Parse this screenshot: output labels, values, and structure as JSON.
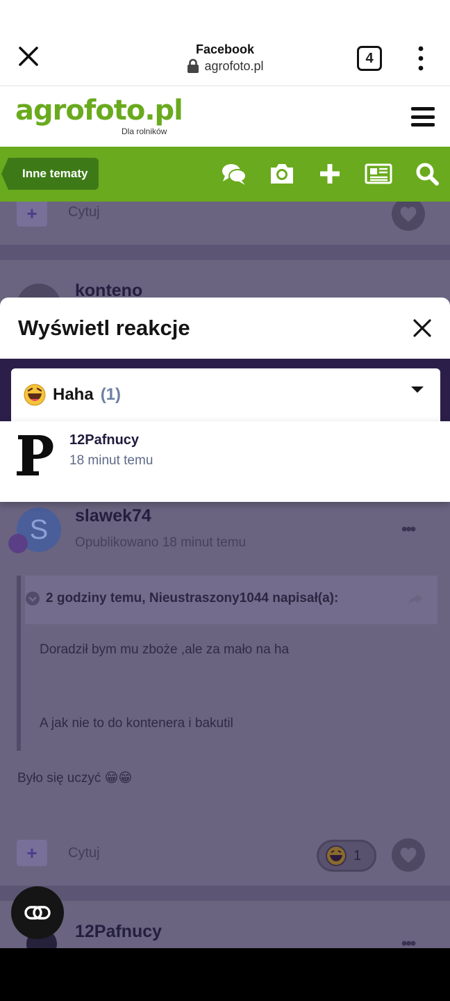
{
  "browser": {
    "site_title": "Facebook",
    "url": "agrofoto.pl",
    "tab_count": "4",
    "icons": [
      "close-icon",
      "lock-icon",
      "more-vert-icon"
    ]
  },
  "site": {
    "logo": "agrofoto.pl",
    "tagline": "Dla rolników",
    "brand_color": "#6aaa1e",
    "brand_dark": "#3d7a17"
  },
  "toolbar": {
    "topics_label": "Inne tematy",
    "icons": [
      "chat-icon",
      "camera-icon",
      "plus-icon",
      "news-icon",
      "search-icon"
    ]
  },
  "background_feed": {
    "top_action": {
      "plus": "+",
      "cite": "Cytuj"
    },
    "partial_user": "konteno",
    "post": {
      "author": "slawek74",
      "avatar_letter": "S",
      "published": "Opublikowano 18 minut temu",
      "more": "•••",
      "quote_header": "2 godziny temu, Nieustraszony1044 napisał(a):",
      "quote_line1": "Doradził bym mu zboże ,ale za mało na ha",
      "quote_line2": "A jak nie to do kontenera i bakutil",
      "body": "Było się uczyć 😁😁",
      "plus": "+",
      "cite": "Cytuj",
      "reaction_count": "1"
    },
    "next_user": "12Pafnucy",
    "next_more": "•••"
  },
  "modal": {
    "title": "Wyświetl reakcje",
    "selected_reaction": {
      "emoji": "😄",
      "label": "Haha",
      "count": "(1)"
    },
    "reactors": [
      {
        "name": "12Pafnucy",
        "time": "18 minut temu",
        "avatar_letter": "P"
      }
    ]
  }
}
